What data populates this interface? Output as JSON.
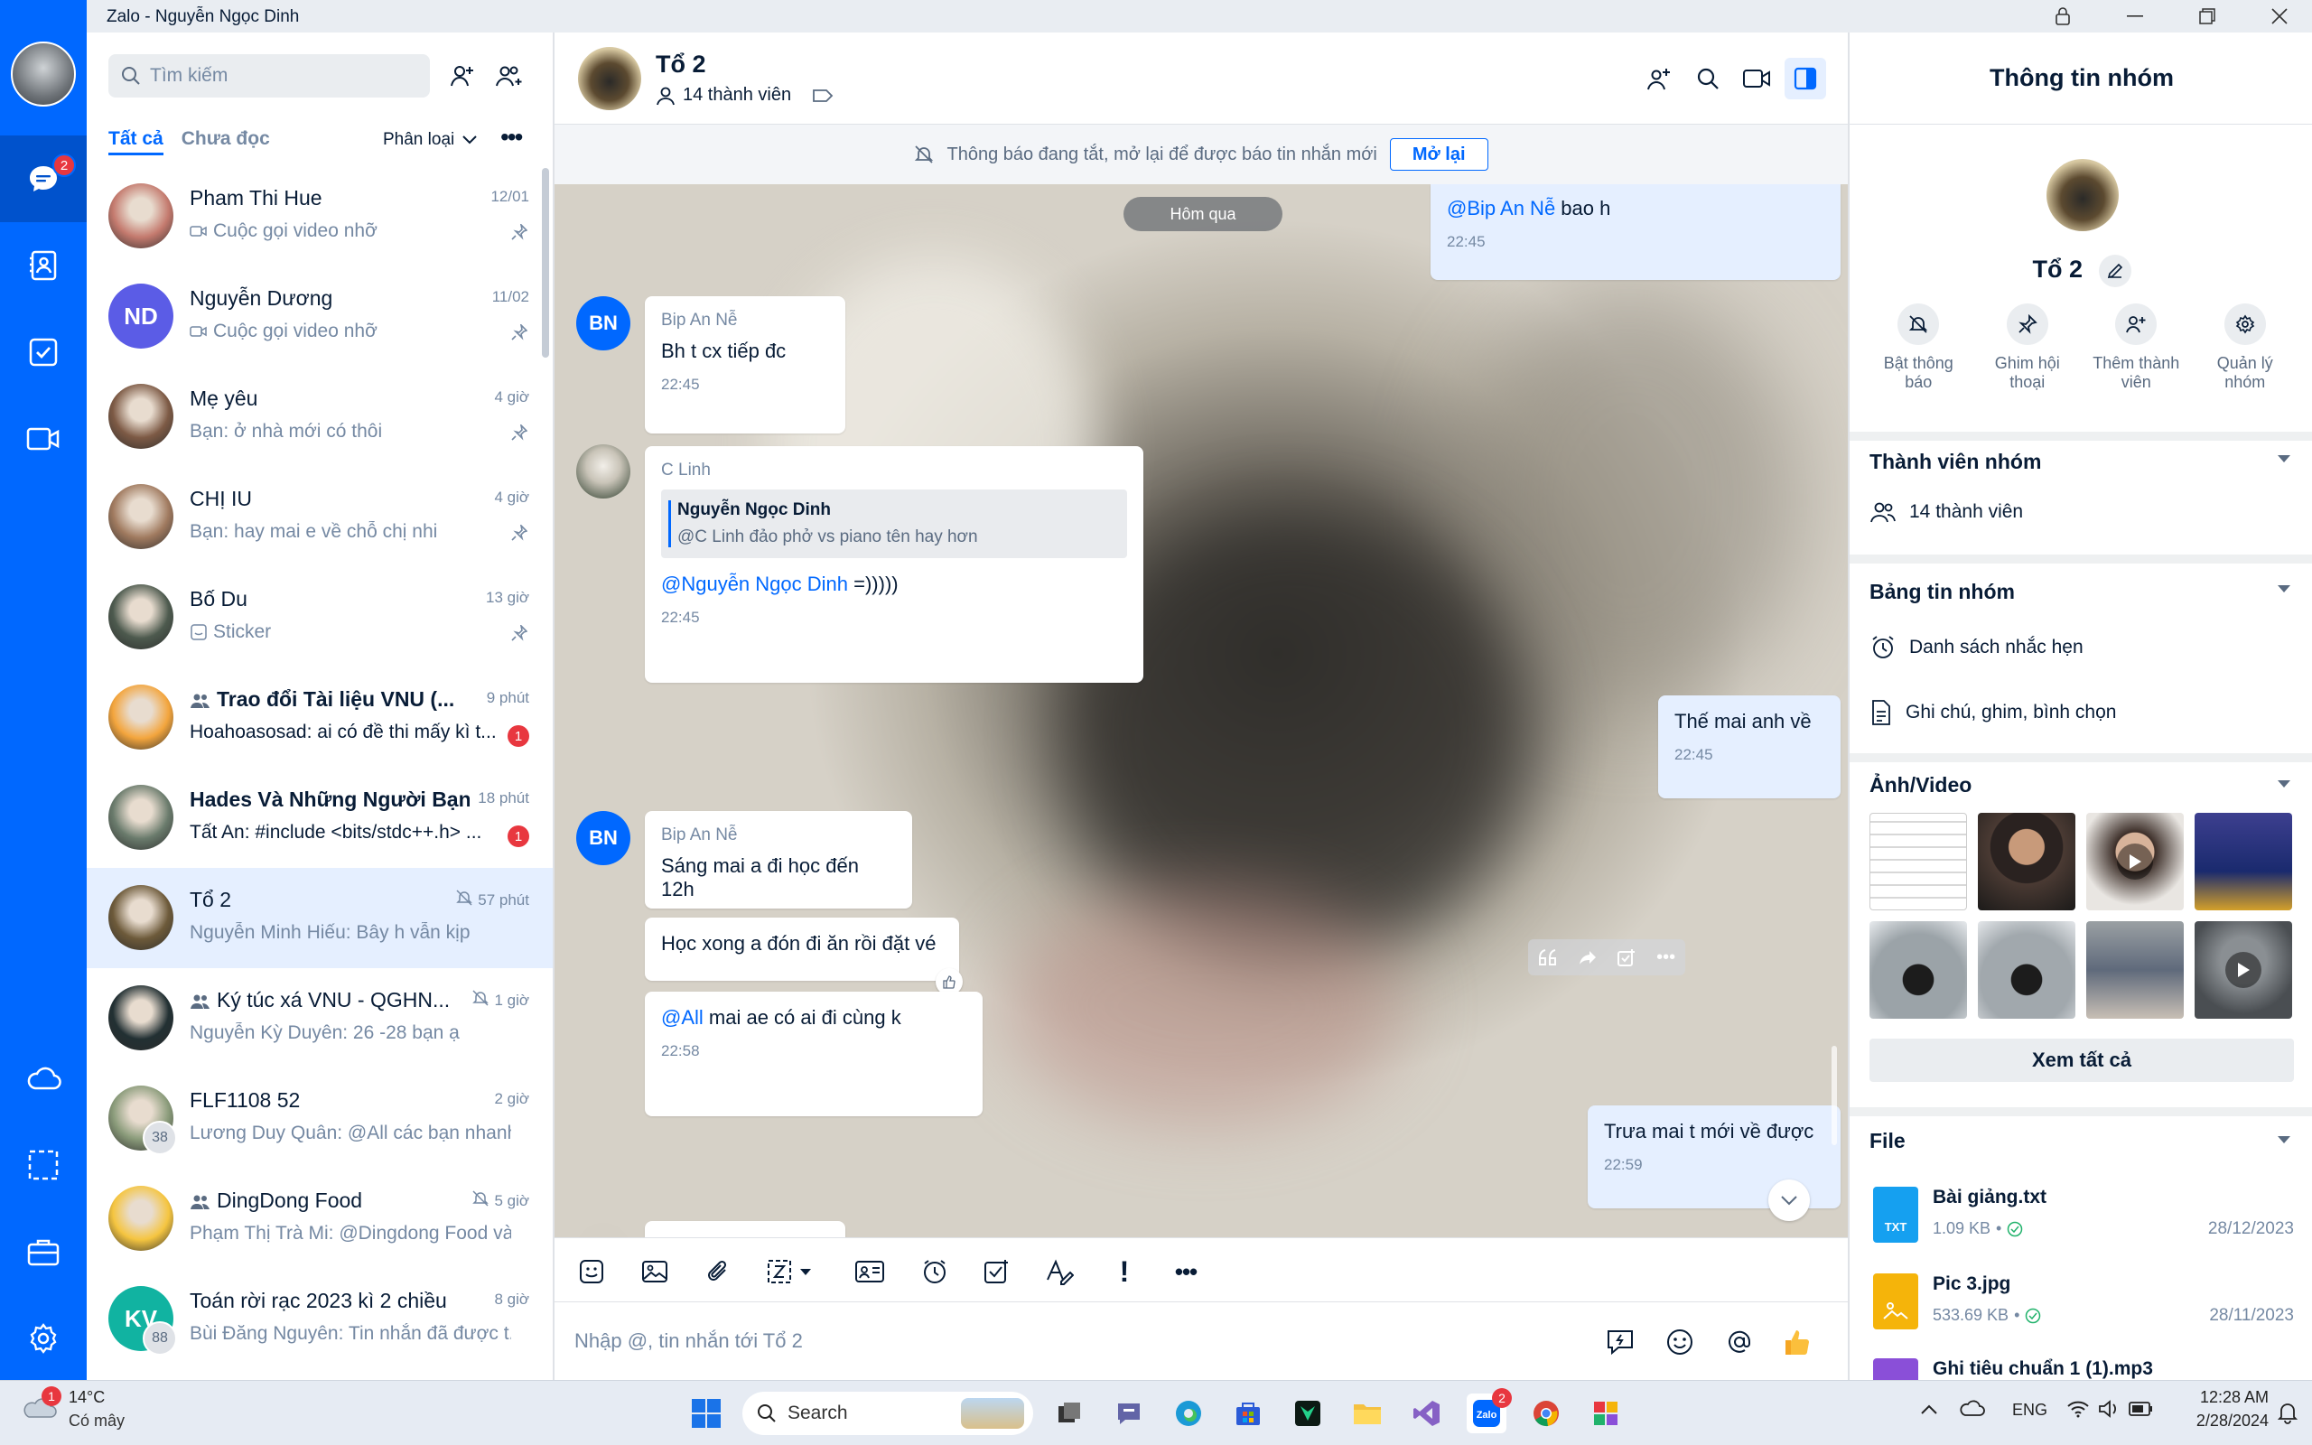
{
  "window": {
    "title": "Zalo - Nguyễn Ngọc Dinh"
  },
  "rail": {
    "messages_badge": "2"
  },
  "left": {
    "search_placeholder": "Tìm kiếm",
    "tab_all": "Tất cả",
    "tab_unread": "Chưa đọc",
    "classify": "Phân loại",
    "conversations": [
      {
        "name": "Pham Thi Hue",
        "time": "12/01",
        "last": "Cuộc gọi video nhỡ",
        "pinned": true,
        "avatar_color": "#c47a6e"
      },
      {
        "name": "Nguyễn Dương",
        "time": "11/02",
        "last": "Cuộc gọi video nhỡ",
        "pinned": true,
        "avatar_initials": "ND",
        "avatar_color": "#5b5ce6"
      },
      {
        "name": "Mẹ yêu",
        "time": "4 giờ",
        "last": "Bạn: ở nhà mới có thôi",
        "pinned": true,
        "avatar_color": "#7d5a45"
      },
      {
        "name": "CHỊ IU",
        "time": "4 giờ",
        "last": "Bạn: hay mai e về chỗ chị nhi",
        "pinned": true,
        "avatar_color": "#a07a5f"
      },
      {
        "name": "Bố Du",
        "time": "13 giờ",
        "last": "Sticker",
        "pinned": true,
        "avatar_color": "#4d5a4e"
      },
      {
        "name": "Trao đổi Tài liệu VNU (...",
        "time": "9 phút",
        "last": "Hoahoasosad: ai có đề thi mấy kì t...",
        "unread": "1",
        "group": true,
        "bold": true,
        "avatar_color": "#f3a53d"
      },
      {
        "name": "Hades Và Những Người Bạn",
        "time": "18 phút",
        "last": "Tất An: #include <bits/stdc++.h> ...",
        "unread": "1",
        "bold": true,
        "avatar_color": "#6a7b6c"
      },
      {
        "name": "Tổ 2",
        "time": "57 phút",
        "last": "Nguyễn Minh Hiếu: Bây h vẫn kịp",
        "muted": true,
        "selected": true,
        "avatar_color": "#6d5a3a"
      },
      {
        "name": "Ký túc xá VNU - QGHN...",
        "time": "1 giờ",
        "last": "Nguyễn Kỳ Duyên: 26 -28 bạn ạ",
        "muted": true,
        "group": true,
        "avatar_color": "#223033"
      },
      {
        "name": "FLF1108 52",
        "time": "2 giờ",
        "last": "Lương Duy Quân: @All các bạn nhanh...",
        "count": "38",
        "avatar_color": "#8a9b7a"
      },
      {
        "name": "DingDong Food",
        "time": "5 giờ",
        "last": "Phạm Thị Trà Mi: @Dingdong Food và...",
        "muted": true,
        "group": true,
        "avatar_color": "#f5c540"
      },
      {
        "name": "Toán rời rạc 2023 kì 2 chiều",
        "time": "8 giờ",
        "last": "Bùi Đăng Nguyên: Tin nhắn đã được t...",
        "count": "88",
        "avatar_initials": "KV",
        "avatar_color": "#11b3a1"
      }
    ]
  },
  "chat": {
    "name": "Tổ 2",
    "members": "14 thành viên",
    "notice_text": "Thông báo đang tắt, mở lại để được báo tin nhắn mới",
    "notice_button": "Mở lại",
    "date_pill": "Hôm qua",
    "messages": {
      "m1_mention": "@Bip An Nễ",
      "m1_text": " bao h",
      "m1_time": "22:45",
      "m2_sender": "Bip An Nễ",
      "m2_text": "Bh t cx tiếp đc",
      "m2_time": "22:45",
      "m3_sender": "C Linh",
      "m3_quote_name": "Nguyễn Ngọc Dinh",
      "m3_quote_text": "@C Linh đảo phở vs piano tên hay hơn",
      "m3_mention": "@Nguyễn Ngọc Dinh",
      "m3_text": " =)))))",
      "m3_time": "22:45",
      "m4_text": "Thế mai anh về",
      "m4_time": "22:45",
      "m5_sender": "Bip An Nễ",
      "m5_text": "Sáng mai a đi học đến 12h",
      "m6_text": "Học xong a đón đi ăn rồi đặt vé",
      "m7_mention": "@All",
      "m7_text": " mai ae có ai đi cùng k",
      "m7_time": "22:58",
      "m8_text": "Trưa mai t mới về được",
      "m8_time": "22:59",
      "bn_initials": "BN"
    },
    "composer_placeholder": "Nhập @, tin nhắn tới Tổ 2"
  },
  "info": {
    "title": "Thông tin nhóm",
    "group_name": "Tổ 2",
    "actions": [
      {
        "label": "Bật thông báo"
      },
      {
        "label": "Ghim hội thoại"
      },
      {
        "label": "Thêm thành viên"
      },
      {
        "label": "Quản lý nhóm"
      }
    ],
    "members_head": "Thành viên nhóm",
    "members_count": "14 thành viên",
    "board_head": "Bảng tin nhóm",
    "reminders": "Danh sách nhắc hẹn",
    "notes": "Ghi chú, ghim, bình chọn",
    "media_head": "Ảnh/Video",
    "see_all": "Xem tất cả",
    "file_head": "File",
    "files": [
      {
        "name": "Bài giảng.txt",
        "size": "1.09 KB",
        "date": "28/12/2023",
        "type": "TXT",
        "color": "#15a0f0"
      },
      {
        "name": "Pic 3.jpg",
        "size": "533.69 KB",
        "date": "28/11/2023",
        "type": "IMG",
        "color": "#f5b40a"
      },
      {
        "name": "Ghi tiêu chuẩn 1 (1).mp3",
        "size": "",
        "date": "",
        "type": "MP3",
        "color": "#8a4fd8"
      }
    ]
  },
  "taskbar": {
    "weather_temp": "14°C",
    "weather_desc": "Có mây",
    "weather_badge": "1",
    "search": "Search",
    "lang": "ENG",
    "time": "12:28 AM",
    "date": "2/28/2024",
    "zalo_badge": "2"
  }
}
